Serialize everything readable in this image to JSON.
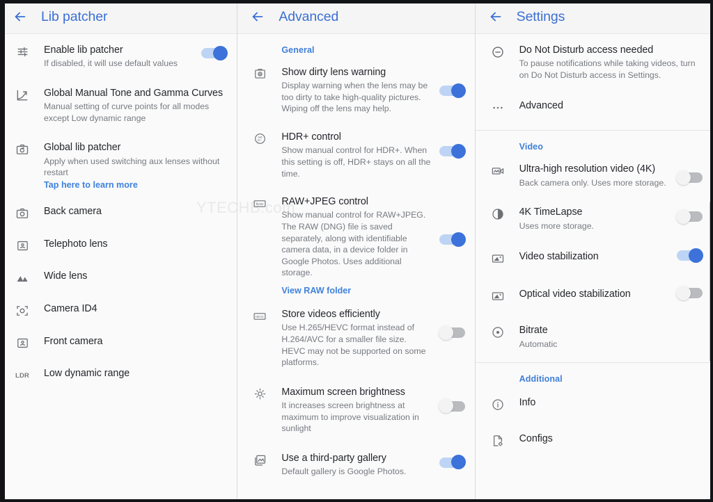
{
  "watermark": "YTECHB.com",
  "panels": [
    {
      "id": "lib-patcher",
      "title": "Lib patcher",
      "back_icon": "arrow-back-icon",
      "items": [
        {
          "icon": "tune-sliders-icon",
          "title": "Enable lib patcher",
          "subtitle": "If disabled, it will use default values",
          "toggle": "on"
        },
        {
          "icon": "tone-curve-icon",
          "title": "Global Manual Tone and Gamma Curves",
          "subtitle": "Manual setting of curve points for all modes except Low dynamic range",
          "toggle": null
        },
        {
          "icon": "camera-refresh-icon",
          "title": "Global lib patcher",
          "subtitle": "Apply when used switching aux lenses without restart",
          "link": "Tap here to learn more",
          "toggle": null
        },
        {
          "icon": "camera-icon",
          "title": "Back camera",
          "subtitle": null,
          "toggle": null
        },
        {
          "icon": "portrait-box-icon",
          "title": "Telephoto lens",
          "subtitle": null,
          "toggle": null
        },
        {
          "icon": "wide-lens-icon",
          "title": "Wide lens",
          "subtitle": null,
          "toggle": null
        },
        {
          "icon": "camera-id-frame-icon",
          "title": "Camera ID4",
          "subtitle": null,
          "toggle": null
        },
        {
          "icon": "portrait-box-icon",
          "title": "Front camera",
          "subtitle": null,
          "toggle": null
        },
        {
          "icon": "ldr-text-icon",
          "title": "Low dynamic range",
          "subtitle": null,
          "toggle": null
        }
      ]
    },
    {
      "id": "advanced",
      "title": "Advanced",
      "back_icon": "arrow-back-icon",
      "section": "General",
      "items": [
        {
          "icon": "dirty-lens-icon",
          "title": "Show dirty lens warning",
          "subtitle": "Display warning when the lens may be too dirty to take high-quality pictures. Wiping off the lens may help.",
          "toggle": "on"
        },
        {
          "icon": "hdr-plus-icon",
          "title": "HDR+ control",
          "subtitle": "Show manual control for HDR+. When this setting is off, HDR+ stays on all the time.",
          "toggle": "on"
        },
        {
          "icon": "raw-badge-icon",
          "title": "RAW+JPEG control",
          "subtitle": "Show manual control for RAW+JPEG. The RAW (DNG) file is saved separately, along with identifiable camera data, in a device folder in Google Photos. Uses additional storage.",
          "link": "View RAW folder",
          "toggle": "on"
        },
        {
          "icon": "hevc-badge-icon",
          "title": "Store videos efficiently",
          "subtitle": "Use H.265/HEVC format instead of H.264/AVC for a smaller file size. HEVC may not be supported on some platforms.",
          "toggle": "off"
        },
        {
          "icon": "brightness-icon",
          "title": "Maximum screen brightness",
          "subtitle": "It increases screen brightness at maximum to improve visualization in sunlight",
          "toggle": "off"
        },
        {
          "icon": "gallery-icon",
          "title": "Use a third-party gallery",
          "subtitle": "Default gallery is Google Photos.",
          "toggle": "on"
        }
      ]
    },
    {
      "id": "settings",
      "title": "Settings",
      "back_icon": "arrow-back-icon",
      "items": [
        {
          "icon": "do-not-disturb-icon",
          "title": "Do Not Disturb access needed",
          "subtitle": "To pause notifications while taking videos, turn on Do Not Disturb access in Settings.",
          "toggle": null
        },
        {
          "icon": "more-horizontal-icon",
          "title": "Advanced",
          "subtitle": null,
          "toggle": null
        }
      ],
      "section_video": "Video",
      "video_items": [
        {
          "icon": "video-4k-icon",
          "title": "Ultra-high resolution video (4K)",
          "subtitle": "Back camera only. Uses more storage.",
          "toggle": "off"
        },
        {
          "icon": "timelapse-icon",
          "title": "4K TimeLapse",
          "subtitle": "Uses more storage.",
          "toggle": "off"
        },
        {
          "icon": "stabilization-icon",
          "title": "Video stabilization",
          "subtitle": null,
          "toggle": "on"
        },
        {
          "icon": "stabilization-icon",
          "title": "Optical video stabilization",
          "subtitle": null,
          "toggle": "off"
        },
        {
          "icon": "bitrate-icon",
          "title": "Bitrate",
          "subtitle": "Automatic",
          "toggle": null
        }
      ],
      "section_additional": "Additional",
      "additional_items": [
        {
          "icon": "info-icon",
          "title": "Info",
          "subtitle": null,
          "toggle": null
        },
        {
          "icon": "configs-file-icon",
          "title": "Configs",
          "subtitle": null,
          "toggle": null
        }
      ]
    }
  ]
}
